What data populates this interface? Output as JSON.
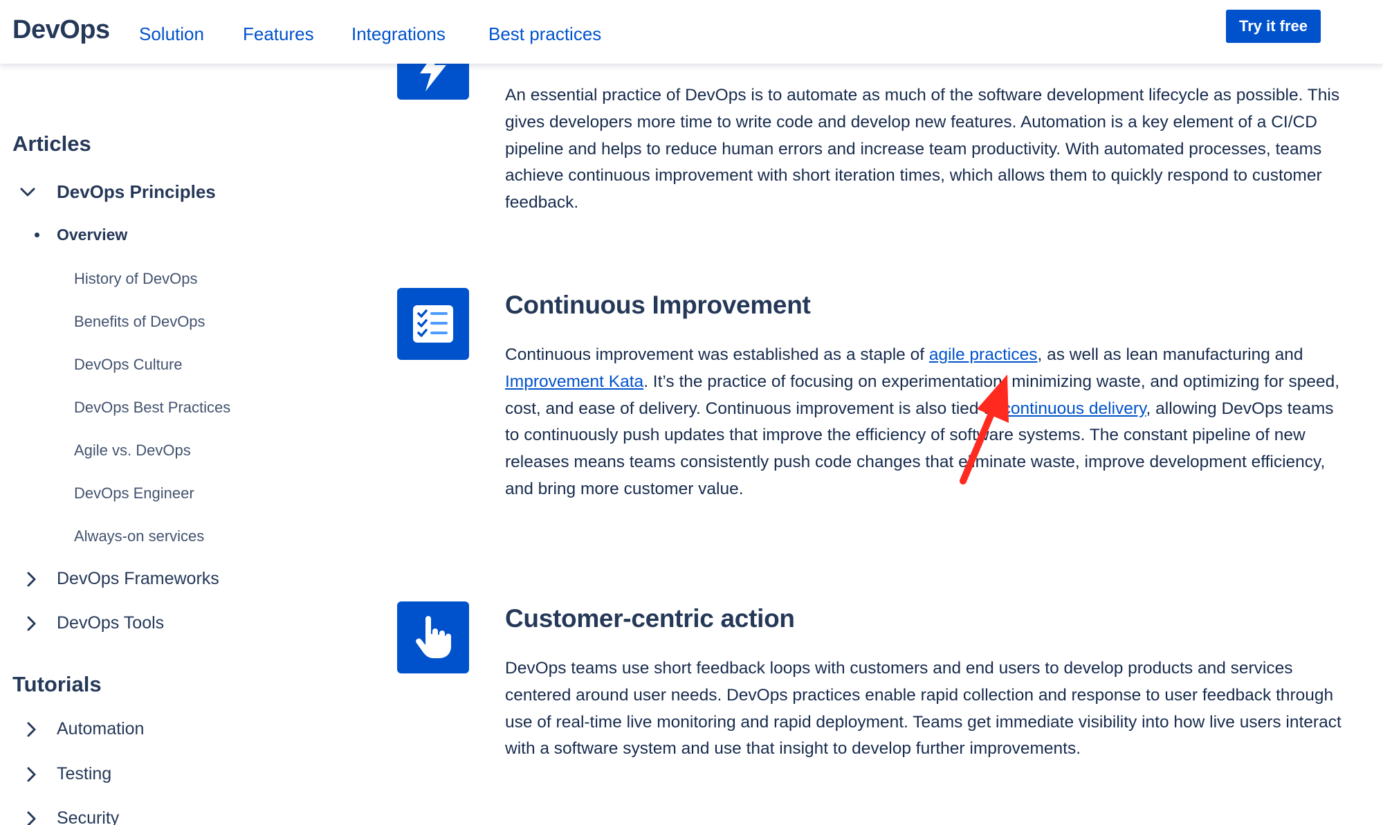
{
  "header": {
    "logo": "DevOps",
    "nav": [
      "Solution",
      "Features",
      "Integrations",
      "Best practices"
    ],
    "cta": "Try it free"
  },
  "sidebar": {
    "articles_heading": "Articles",
    "principles": "DevOps Principles",
    "overview": "Overview",
    "sub_items": [
      "History of DevOps",
      "Benefits of DevOps",
      "DevOps Culture",
      "DevOps Best Practices",
      "Agile vs. DevOps",
      "DevOps Engineer",
      "Always-on services"
    ],
    "frameworks": "DevOps Frameworks",
    "tools": "DevOps Tools",
    "tutorials_heading": "Tutorials",
    "tutorials": [
      "Automation",
      "Testing",
      "Security"
    ]
  },
  "sections": {
    "automation": {
      "text": "An essential practice of DevOps is to automate as much of the software development lifecycle as possible. This gives developers more time to write code and develop new features. Automation is a key element of a CI/CD pipeline and helps to reduce human errors and increase team productivity. With automated processes, teams achieve continuous improvement with short iteration times, which allows them to quickly respond to customer feedback."
    },
    "improvement": {
      "title": "Continuous Improvement",
      "t1": "Continuous improvement was established as a staple of ",
      "link1": "agile practices",
      "t2": ", as well as lean manufacturing and ",
      "link2": "Improvement Kata",
      "t3": ". It’s the practice of focusing on experimentation, minimizing waste, and optimizing for speed, cost, and ease of delivery. Continuous improvement is also tied to ",
      "link3": "continuous delivery",
      "t4": ", allowing DevOps teams to continuously push updates that improve the efficiency of software systems. The constant pipeline of new releases means teams consistently push code changes that eliminate waste, improve development efficiency, and bring more customer value."
    },
    "customer": {
      "title": "Customer-centric action",
      "text": "DevOps teams use short feedback loops with customers and end users to develop products and services centered around user needs. DevOps practices enable rapid collection and response to user feedback through use of real-time live monitoring and rapid deployment. Teams get immediate visibility into how live users interact with a software system and use that insight to develop further improvements."
    }
  },
  "colors": {
    "brand": "#0052CC",
    "text": "#172B4D",
    "heading": "#253858",
    "annotation": "#FF2A1F"
  },
  "icons": [
    "lightning-icon",
    "checklist-icon",
    "pointing-hand-icon",
    "chevron-down-icon",
    "chevron-right-icon"
  ]
}
